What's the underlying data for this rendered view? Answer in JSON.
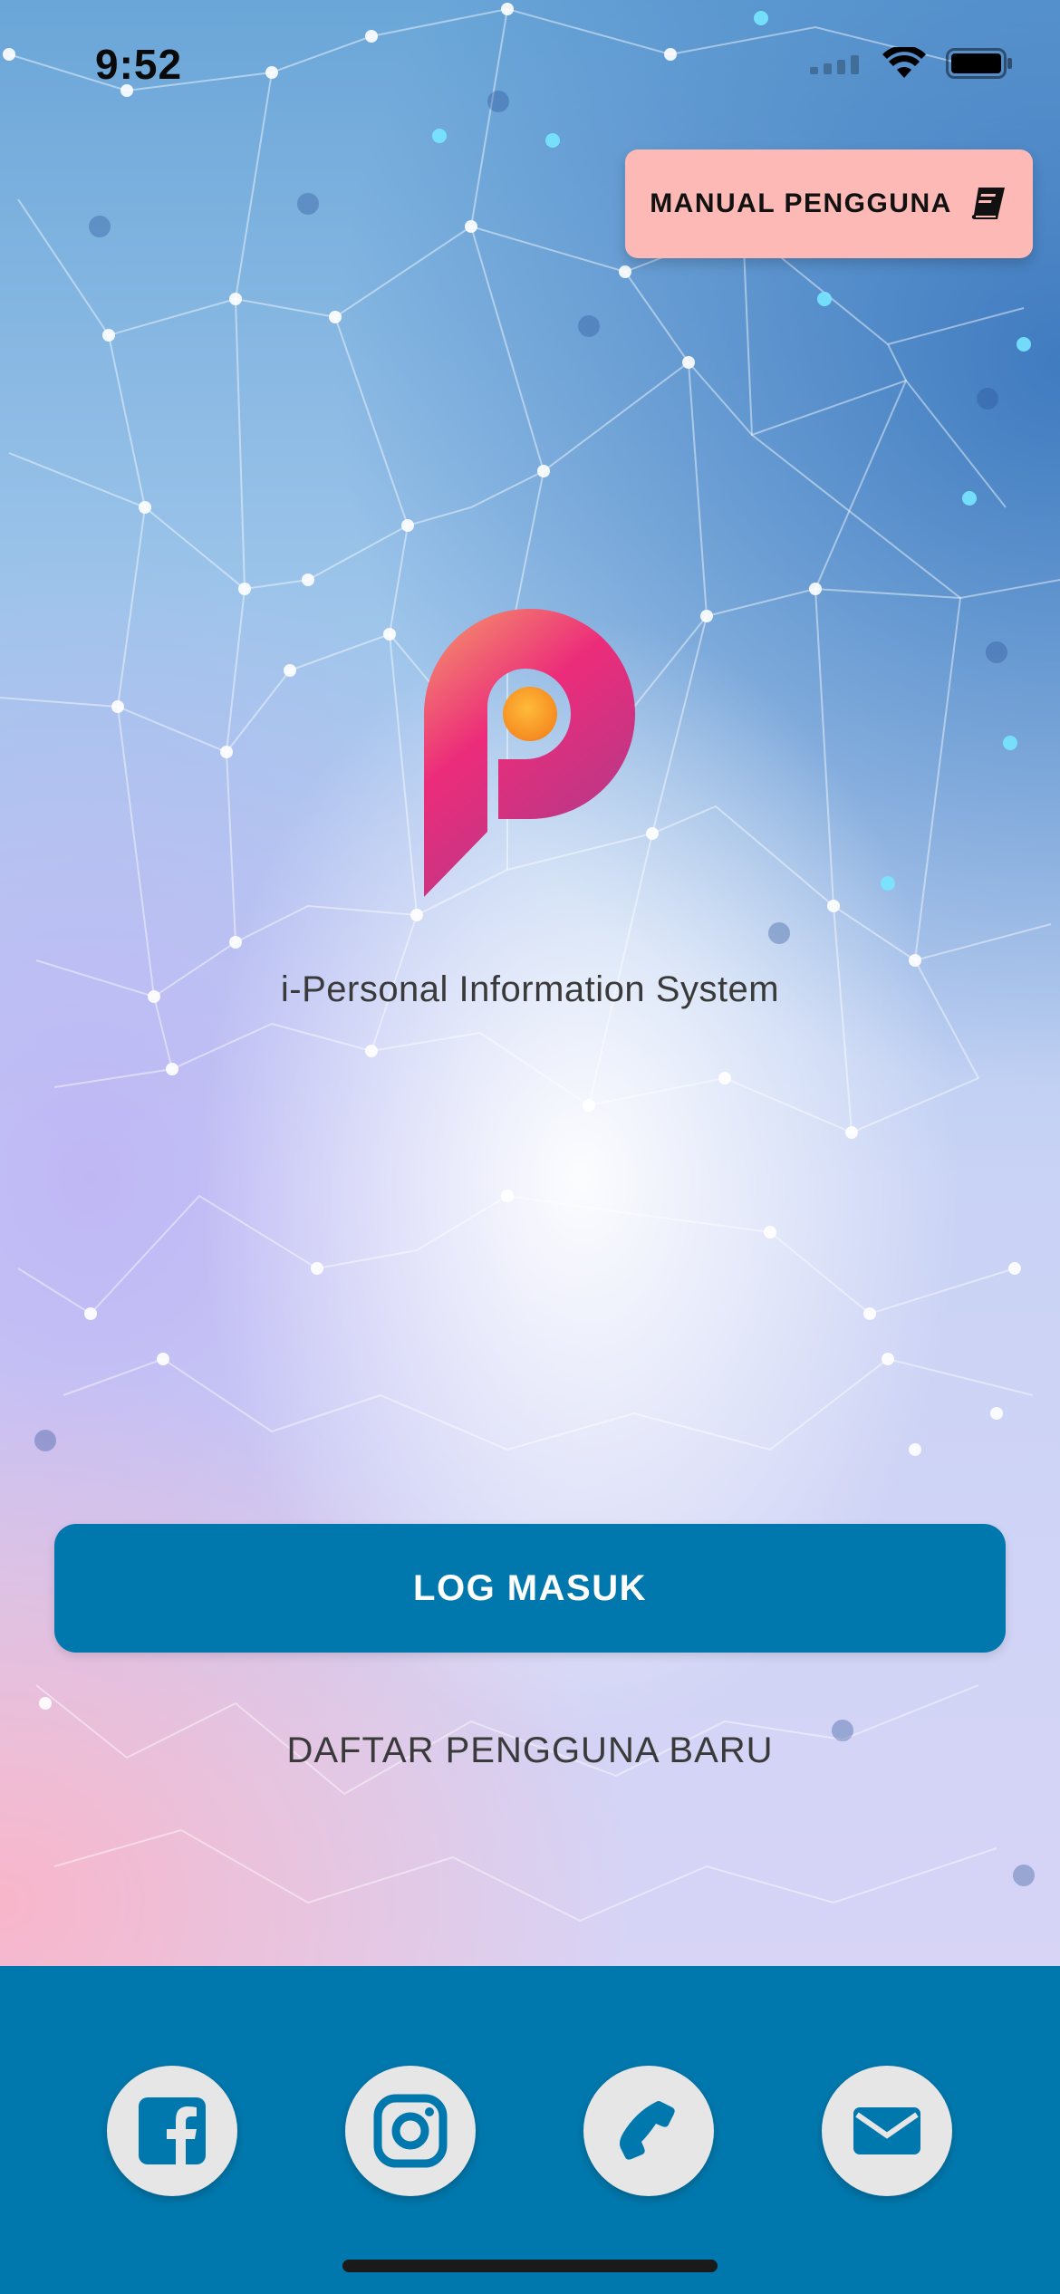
{
  "status_bar": {
    "time": "9:52"
  },
  "header": {
    "manual_button_label": "MANUAL PENGGUNA",
    "manual_icon": "book-icon"
  },
  "app": {
    "title": "i-Personal Information System"
  },
  "actions": {
    "login_label": "LOG MASUK",
    "register_label": "DAFTAR PENGGUNA BARU"
  },
  "footer": {
    "social": [
      {
        "name": "facebook",
        "icon": "facebook-icon"
      },
      {
        "name": "instagram",
        "icon": "instagram-icon"
      },
      {
        "name": "phone",
        "icon": "phone-icon"
      },
      {
        "name": "email",
        "icon": "mail-icon"
      }
    ]
  },
  "colors": {
    "primary": "#0078ad",
    "manual_button_bg": "#fdb9b6",
    "text_dark": "#3a3a3a",
    "social_bg": "#e6e6e6"
  }
}
